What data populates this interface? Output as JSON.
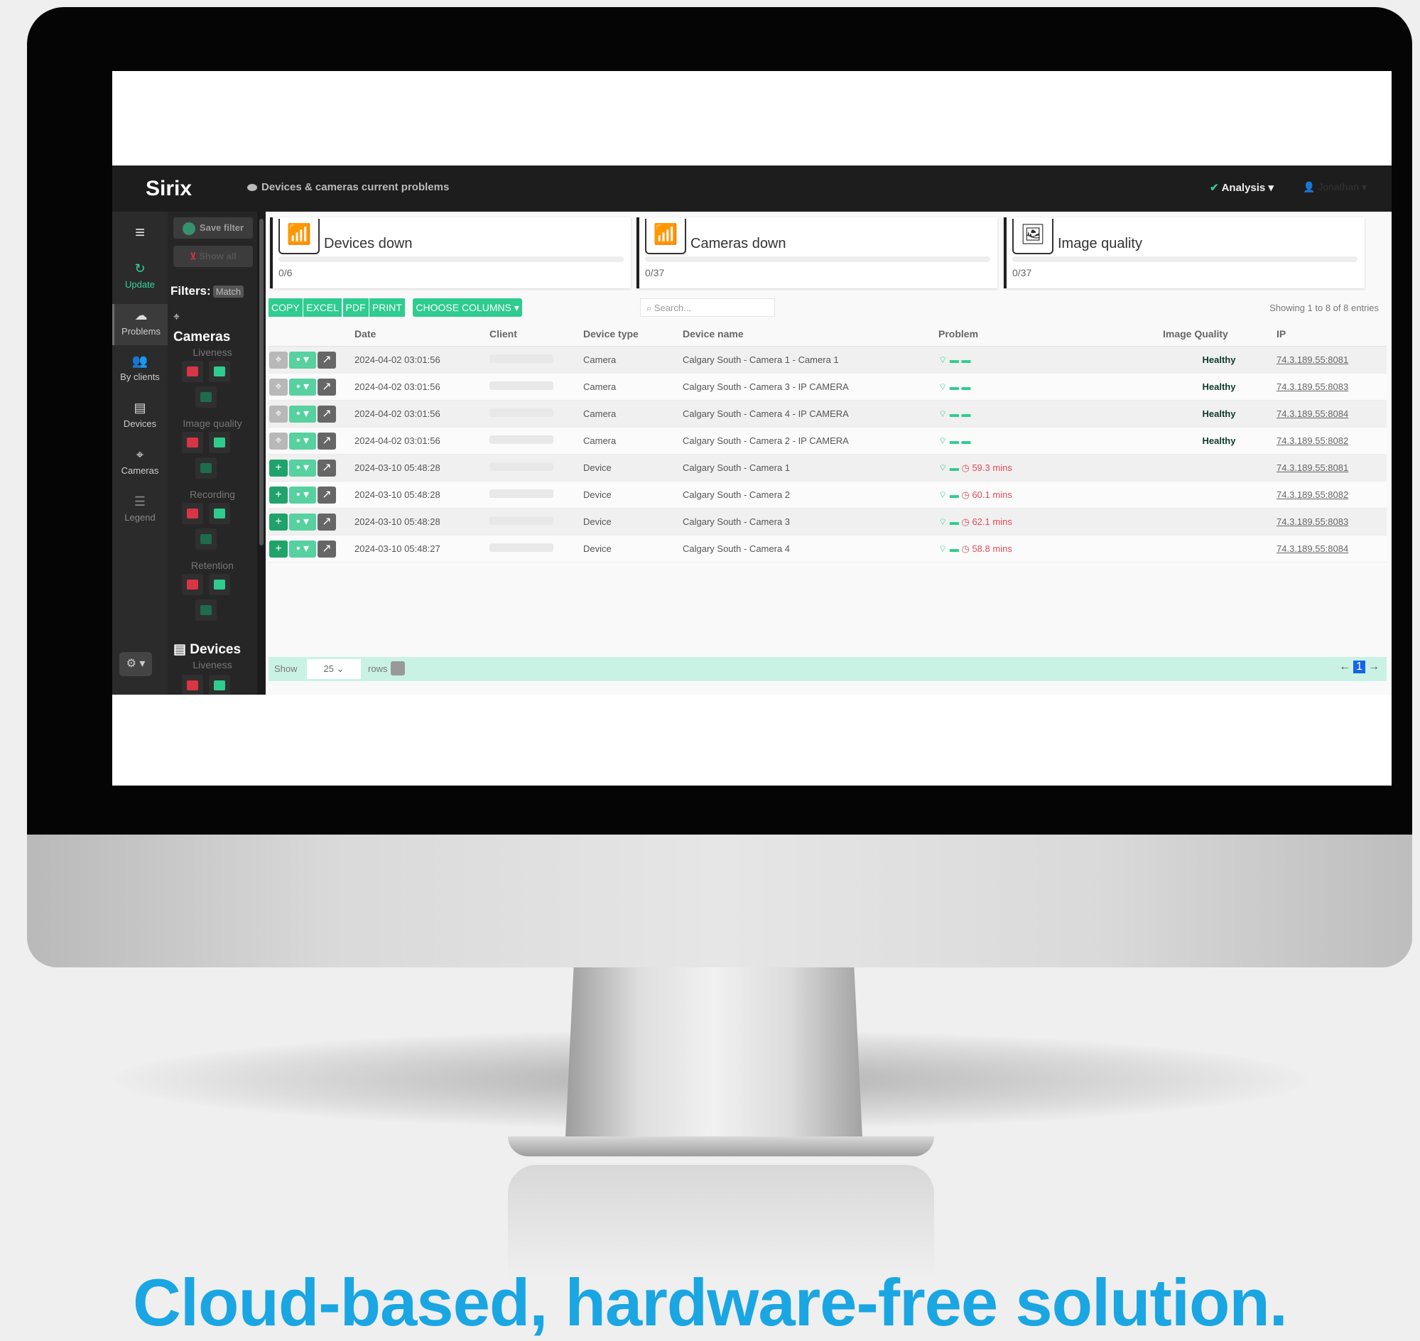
{
  "topbar": {
    "brand": "Sirix",
    "breadcrumb": "Devices & cameras current problems",
    "analysis_label": "Analysis",
    "user_label": "Jonathan"
  },
  "rail": {
    "items": [
      {
        "label": "Update",
        "icon": "refresh-icon"
      },
      {
        "label": "Problems",
        "icon": "cloud-icon"
      },
      {
        "label": "By clients",
        "icon": "users-icon"
      },
      {
        "label": "Devices",
        "icon": "server-icon"
      },
      {
        "label": "Cameras",
        "icon": "camera-icon"
      },
      {
        "label": "Legend",
        "icon": "list-icon"
      }
    ]
  },
  "filters": {
    "save_filter": "Save filter",
    "show_all": "Show all",
    "filters_label": "Filters:",
    "match_label": "Match",
    "cameras_title": "Cameras",
    "cameras_groups": [
      "Liveness",
      "Image quality",
      "Recording",
      "Retention"
    ],
    "devices_title": "Devices",
    "devices_groups": [
      "Liveness"
    ]
  },
  "cards": [
    {
      "title": "Devices down",
      "value": "0/6",
      "icon": "wifi-icon"
    },
    {
      "title": "Cameras down",
      "value": "0/37",
      "icon": "wifi-icon"
    },
    {
      "title": "Image quality",
      "value": "0/37",
      "icon": "image-icon"
    }
  ],
  "toolbar": {
    "buttons": [
      "COPY",
      "EXCEL",
      "PDF",
      "PRINT"
    ],
    "choose_columns": "CHOOSE COLUMNS",
    "search_placeholder": "Search...",
    "showing": "Showing 1 to 8 of 8 entries"
  },
  "table": {
    "headers": [
      "",
      "Date",
      "Client",
      "Device type",
      "Device name",
      "Problem",
      "Image Quality",
      "IP"
    ],
    "rows": [
      {
        "date": "2024-04-02 03:01:56",
        "type": "Camera",
        "name": "Calgary South - Camera 1 - Camera 1",
        "problem": "",
        "quality": "Healthy",
        "ip": "74.3.189.55:8081",
        "kind": "camera"
      },
      {
        "date": "2024-04-02 03:01:56",
        "type": "Camera",
        "name": "Calgary South - Camera 3 - IP CAMERA",
        "problem": "",
        "quality": "Healthy",
        "ip": "74.3.189.55:8083",
        "kind": "camera"
      },
      {
        "date": "2024-04-02 03:01:56",
        "type": "Camera",
        "name": "Calgary South - Camera 4 - IP CAMERA",
        "problem": "",
        "quality": "Healthy",
        "ip": "74.3.189.55:8084",
        "kind": "camera"
      },
      {
        "date": "2024-04-02 03:01:56",
        "type": "Camera",
        "name": "Calgary South - Camera 2 - IP CAMERA",
        "problem": "",
        "quality": "Healthy",
        "ip": "74.3.189.55:8082",
        "kind": "camera"
      },
      {
        "date": "2024-03-10 05:48:28",
        "type": "Device",
        "name": "Calgary South - Camera 1",
        "problem": "59.3 mins",
        "quality": "",
        "ip": "74.3.189.55:8081",
        "kind": "device"
      },
      {
        "date": "2024-03-10 05:48:28",
        "type": "Device",
        "name": "Calgary South - Camera 2",
        "problem": "60.1 mins",
        "quality": "",
        "ip": "74.3.189.55:8082",
        "kind": "device"
      },
      {
        "date": "2024-03-10 05:48:28",
        "type": "Device",
        "name": "Calgary South - Camera 3",
        "problem": "62.1 mins",
        "quality": "",
        "ip": "74.3.189.55:8083",
        "kind": "device"
      },
      {
        "date": "2024-03-10 05:48:27",
        "type": "Device",
        "name": "Calgary South - Camera 4",
        "problem": "58.8 mins",
        "quality": "",
        "ip": "74.3.189.55:8084",
        "kind": "device"
      }
    ]
  },
  "footer": {
    "show": "Show",
    "rows_value": "25",
    "rows": "rows",
    "current_page": "1"
  },
  "tagline": "Cloud-based, hardware-free solution.",
  "colors": {
    "accent": "#2ecc8f",
    "alert": "#e04b5b",
    "tagline": "#1aa6e2",
    "page_active": "#1565e8"
  }
}
